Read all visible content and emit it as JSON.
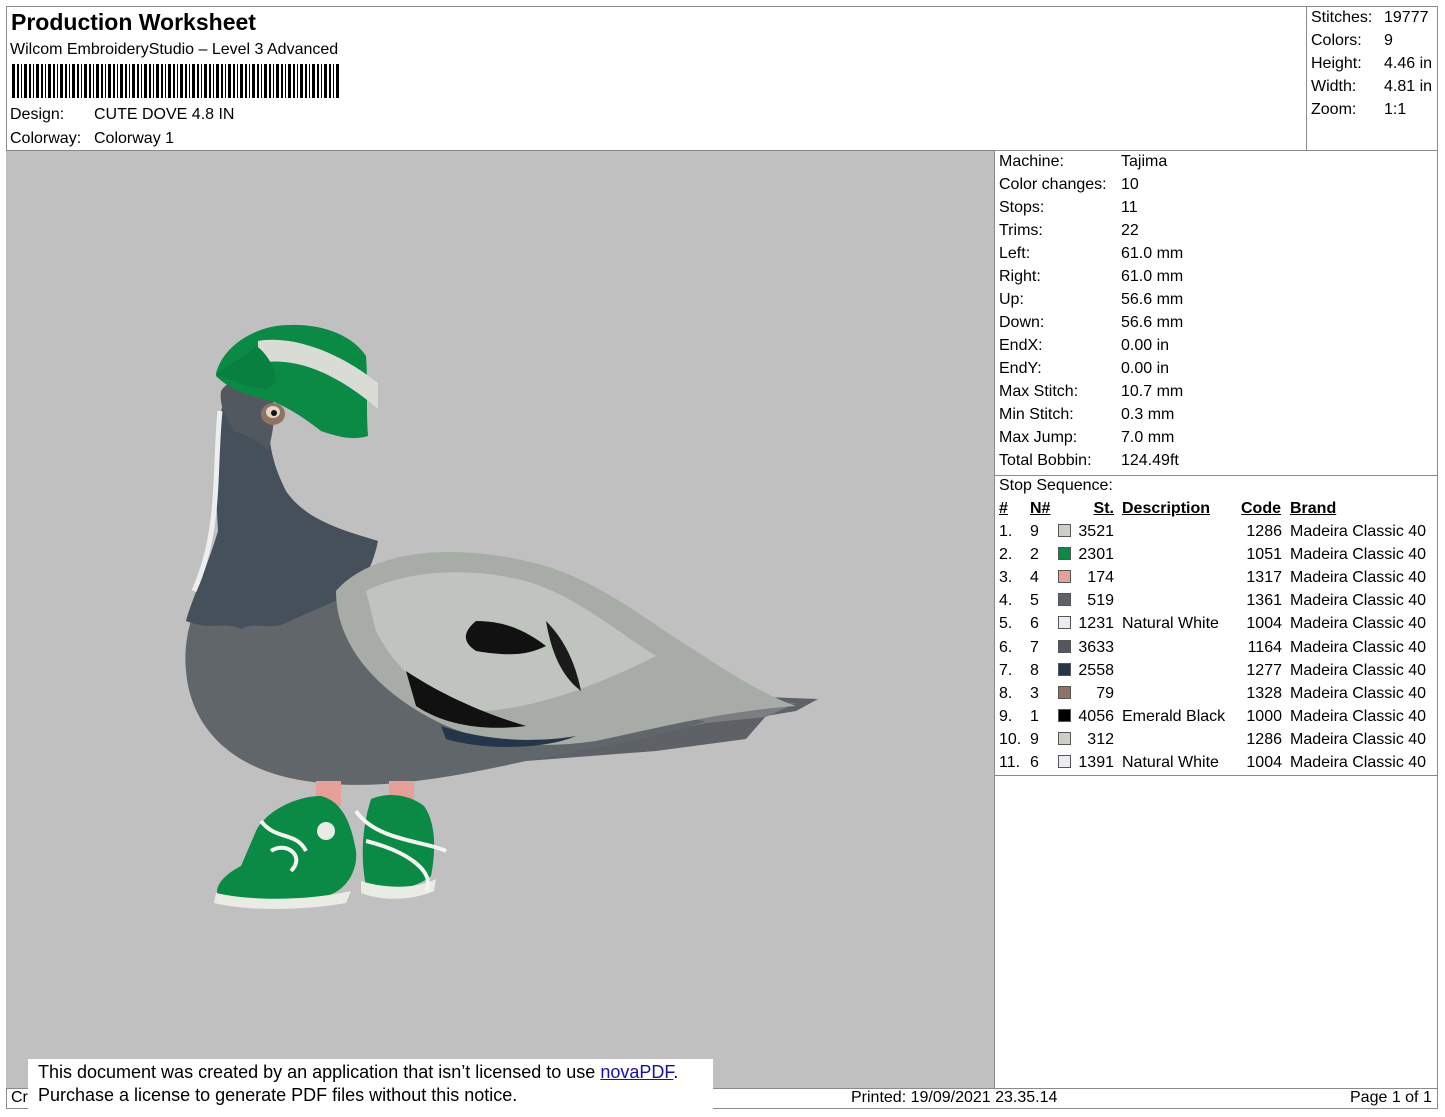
{
  "header": {
    "title": "Production Worksheet",
    "software": "Wilcom EmbroideryStudio – Level 3 Advanced",
    "design_label": "Design:",
    "design_value": "CUTE DOVE 4.8 IN",
    "colorway_label": "Colorway:",
    "colorway_value": "Colorway 1"
  },
  "summary": [
    {
      "label": "Stitches:",
      "value": "19777"
    },
    {
      "label": "Colors:",
      "value": "9"
    },
    {
      "label": "Height:",
      "value": "4.46 in"
    },
    {
      "label": "Width:",
      "value": "4.81 in"
    },
    {
      "label": "Zoom:",
      "value": "1:1"
    }
  ],
  "info": [
    {
      "label": "Machine:",
      "value": "Tajima"
    },
    {
      "label": "Color changes:",
      "value": "10"
    },
    {
      "label": "Stops:",
      "value": "11"
    },
    {
      "label": "Trims:",
      "value": "22"
    },
    {
      "label": "Left:",
      "value": "61.0 mm"
    },
    {
      "label": "Right:",
      "value": "61.0 mm"
    },
    {
      "label": "Up:",
      "value": "56.6 mm"
    },
    {
      "label": "Down:",
      "value": "56.6 mm"
    },
    {
      "label": "EndX:",
      "value": "0.00 in"
    },
    {
      "label": "EndY:",
      "value": "0.00 in"
    },
    {
      "label": "Max Stitch:",
      "value": "10.7 mm"
    },
    {
      "label": "Min Stitch:",
      "value": "0.3 mm"
    },
    {
      "label": "Max Jump:",
      "value": "7.0 mm"
    },
    {
      "label": "Total Bobbin:",
      "value": "124.49ft"
    }
  ],
  "stop_sequence": {
    "title": "Stop Sequence:",
    "headers": {
      "num": "#",
      "n": "N#",
      "st": "St.",
      "description": "Description",
      "code": "Code",
      "brand": "Brand"
    },
    "rows": [
      {
        "num": "1.",
        "n": "9",
        "color": "#cfcdc6",
        "st": "3521",
        "description": "",
        "code": "1286",
        "brand": "Madeira Classic 40"
      },
      {
        "num": "2.",
        "n": "2",
        "color": "#0a8a45",
        "st": "2301",
        "description": "",
        "code": "1051",
        "brand": "Madeira Classic 40"
      },
      {
        "num": "3.",
        "n": "4",
        "color": "#e6a09a",
        "st": "174",
        "description": "",
        "code": "1317",
        "brand": "Madeira Classic 40"
      },
      {
        "num": "4.",
        "n": "5",
        "color": "#5e6166",
        "st": "519",
        "description": "",
        "code": "1361",
        "brand": "Madeira Classic 40"
      },
      {
        "num": "5.",
        "n": "6",
        "color": "#ecebf2",
        "st": "1231",
        "description": "Natural White",
        "code": "1004",
        "brand": "Madeira Classic 40"
      },
      {
        "num": "6.",
        "n": "7",
        "color": "#52585f",
        "st": "3633",
        "description": "",
        "code": "1164",
        "brand": "Madeira Classic 40"
      },
      {
        "num": "7.",
        "n": "8",
        "color": "#26364a",
        "st": "2558",
        "description": "",
        "code": "1277",
        "brand": "Madeira Classic 40"
      },
      {
        "num": "8.",
        "n": "3",
        "color": "#8f7466",
        "st": "79",
        "description": "",
        "code": "1328",
        "brand": "Madeira Classic 40"
      },
      {
        "num": "9.",
        "n": "1",
        "color": "#000000",
        "st": "4056",
        "description": "Emerald Black",
        "code": "1000",
        "brand": "Madeira Classic 40"
      },
      {
        "num": "10.",
        "n": "9",
        "color": "#cfcdc6",
        "st": "312",
        "description": "",
        "code": "1286",
        "brand": "Madeira Classic 40"
      },
      {
        "num": "11.",
        "n": "6",
        "color": "#ecebf2",
        "st": "1391",
        "description": "Natural White",
        "code": "1004",
        "brand": "Madeira Classic 40"
      }
    ]
  },
  "footer": {
    "left_fragment": "Cr",
    "printed": "Printed: 19/09/2021 23.35.14",
    "page": "Page 1 of 1"
  },
  "notice": {
    "line1_prefix": "This document was created by an application that isn’t licensed to use ",
    "link": "novaPDF",
    "line1_suffix": ".",
    "line2": "Purchase a license to generate PDF files without this notice."
  }
}
